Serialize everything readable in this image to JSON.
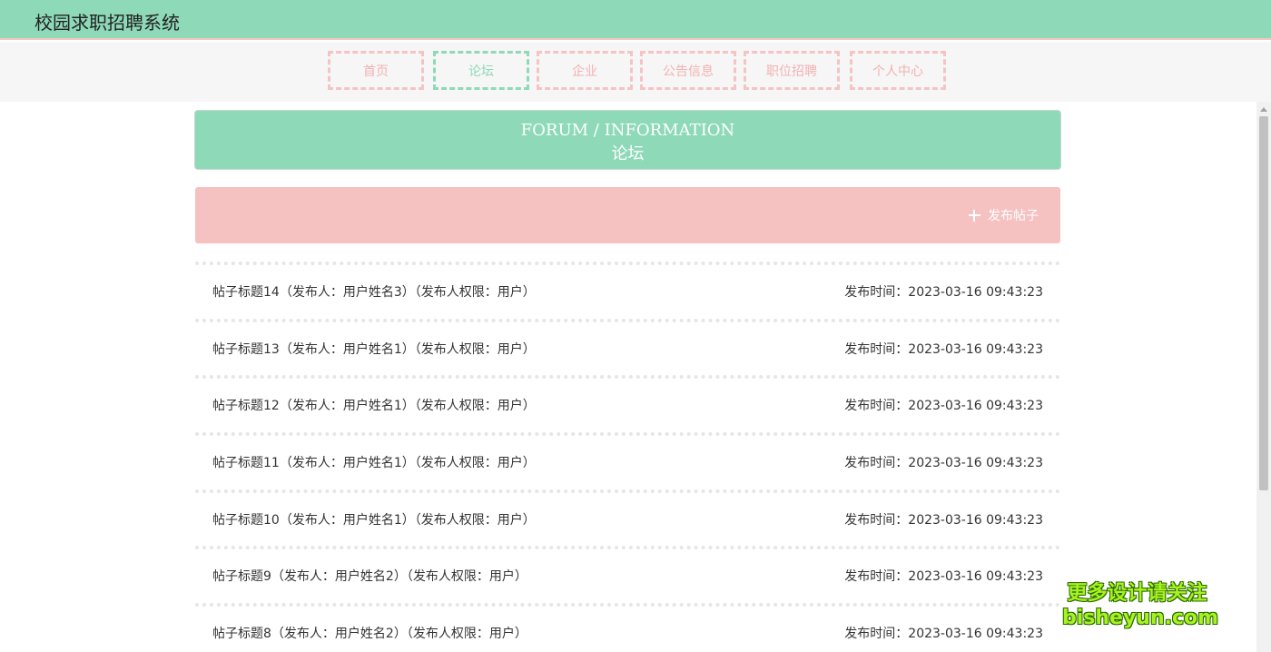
{
  "header": {
    "app_title": "校园求职招聘系统"
  },
  "nav": {
    "items": [
      {
        "label": "首页",
        "active": false
      },
      {
        "label": "论坛",
        "active": true
      },
      {
        "label": "企业",
        "active": false
      },
      {
        "label": "公告信息",
        "active": false
      },
      {
        "label": "职位招聘",
        "active": false
      },
      {
        "label": "个人中心",
        "active": false
      }
    ]
  },
  "banner": {
    "title_en": "FORUM / INFORMATION",
    "title_cn": "论坛"
  },
  "actions": {
    "post_button_label": "发布帖子"
  },
  "posts": [
    {
      "title": "帖子标题14（发布人：用户姓名3）（发布人权限：用户）",
      "time": "发布时间：2023-03-16 09:43:23"
    },
    {
      "title": "帖子标题13（发布人：用户姓名1）（发布人权限：用户）",
      "time": "发布时间：2023-03-16 09:43:23"
    },
    {
      "title": "帖子标题12（发布人：用户姓名1）（发布人权限：用户）",
      "time": "发布时间：2023-03-16 09:43:23"
    },
    {
      "title": "帖子标题11（发布人：用户姓名1）（发布人权限：用户）",
      "time": "发布时间：2023-03-16 09:43:23"
    },
    {
      "title": "帖子标题10（发布人：用户姓名1）（发布人权限：用户）",
      "time": "发布时间：2023-03-16 09:43:23"
    },
    {
      "title": "帖子标题9（发布人：用户姓名2）（发布人权限：用户）",
      "time": "发布时间：2023-03-16 09:43:23"
    },
    {
      "title": "帖子标题8（发布人：用户姓名2）（发布人权限：用户）",
      "time": "发布时间：2023-03-16 09:43:23"
    }
  ],
  "watermark": {
    "line1": "更多设计请关注",
    "line2": "bisheyun.com"
  },
  "colors": {
    "primary": "#8ed9b8",
    "accent": "#f6c1c1",
    "nav_text": "#f3b1b1"
  }
}
